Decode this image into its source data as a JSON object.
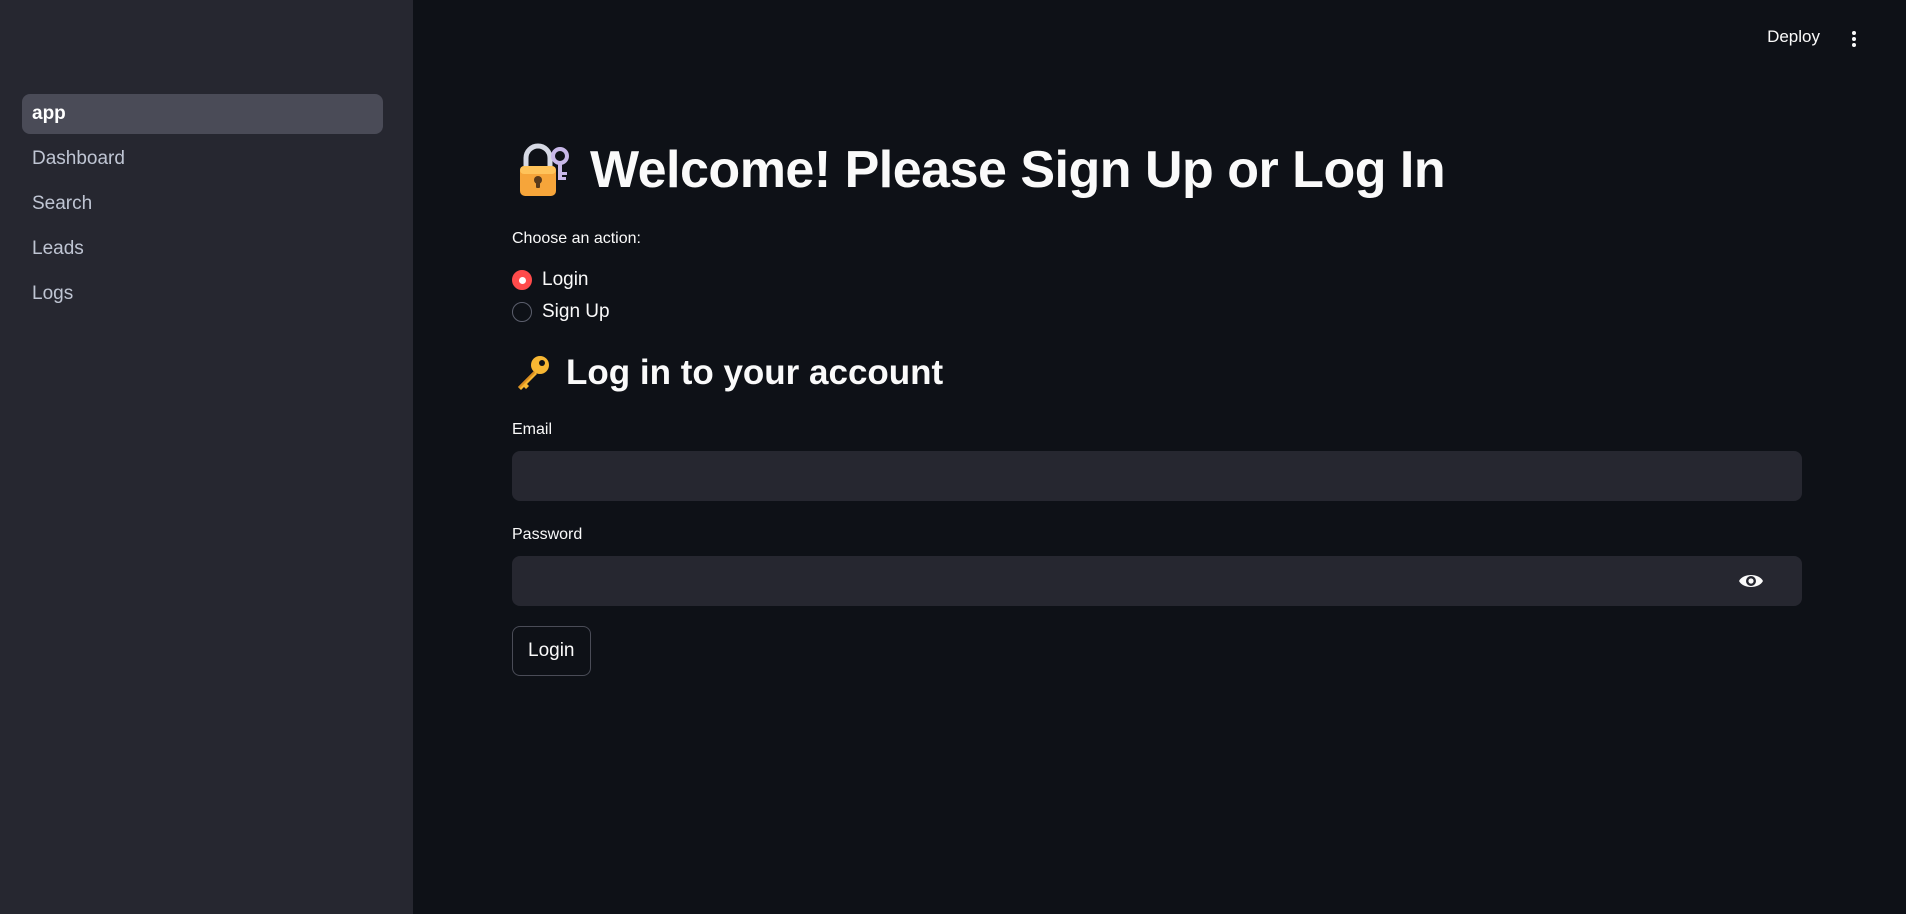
{
  "sidebar": {
    "items": [
      {
        "label": "app",
        "active": true
      },
      {
        "label": "Dashboard",
        "active": false
      },
      {
        "label": "Search",
        "active": false
      },
      {
        "label": "Leads",
        "active": false
      },
      {
        "label": "Logs",
        "active": false
      }
    ]
  },
  "header": {
    "deploy_label": "Deploy",
    "menu_icon": "vertical-ellipsis-icon"
  },
  "main": {
    "title": "Welcome! Please Sign Up or Log In",
    "title_icon": "locked-with-key-icon",
    "radio": {
      "label": "Choose an action:",
      "options": [
        {
          "label": "Login",
          "checked": true
        },
        {
          "label": "Sign Up",
          "checked": false
        }
      ]
    },
    "subheading": "Log in to your account",
    "subheading_icon": "key-icon",
    "email": {
      "label": "Email",
      "value": "",
      "placeholder": ""
    },
    "password": {
      "label": "Password",
      "value": "",
      "placeholder": ""
    },
    "login_button": "Login"
  },
  "colors": {
    "background": "#0e1117",
    "sidebar": "#262730",
    "accent": "#ff4b4b",
    "input_bg": "#262730"
  }
}
